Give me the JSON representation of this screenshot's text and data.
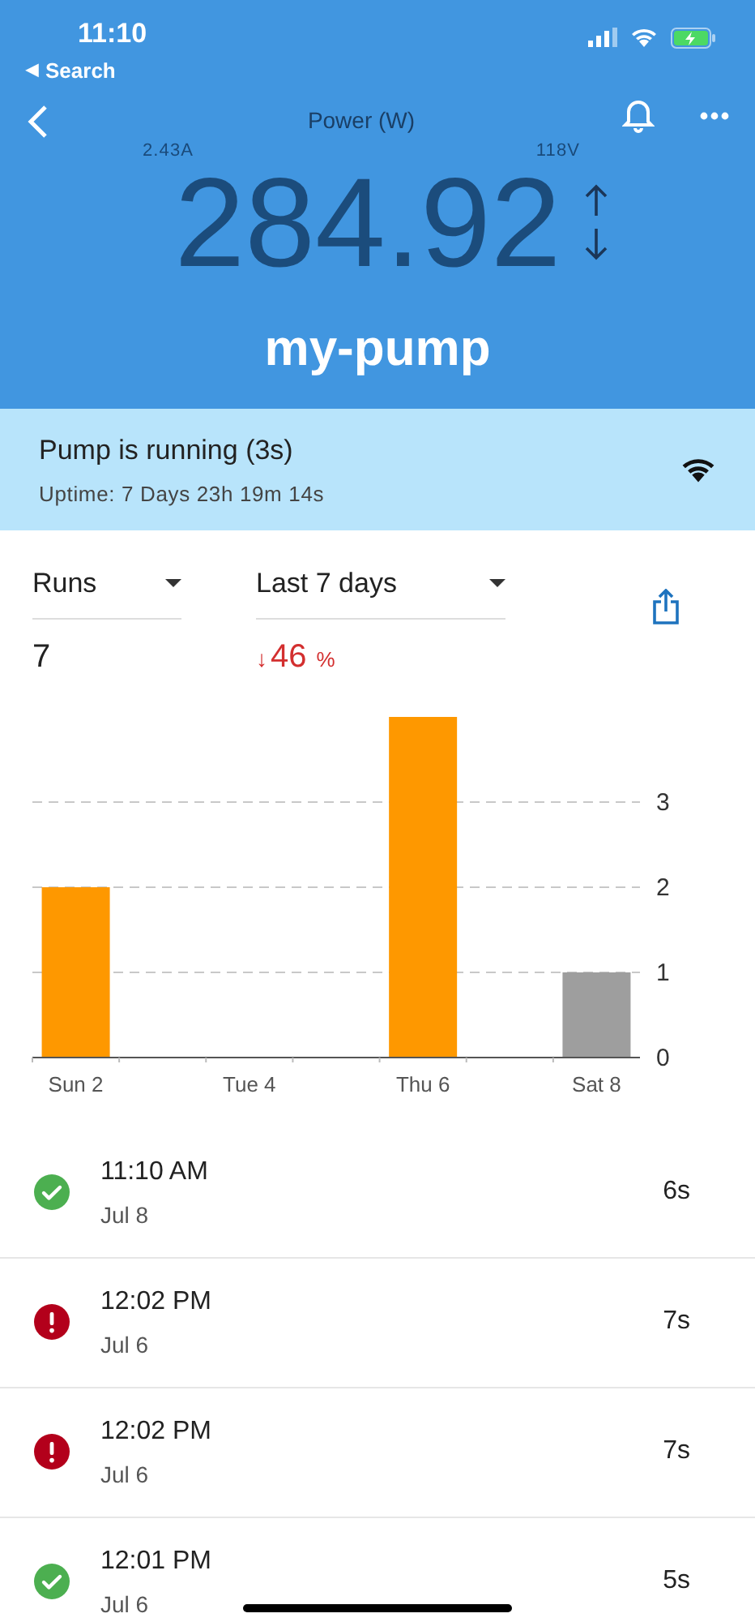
{
  "status_bar": {
    "time": "11:10",
    "back_arrow": "◀",
    "back_label": "Search"
  },
  "header": {
    "title": "Power (W)",
    "current": "2.43A",
    "voltage": "118V",
    "value": "284.92",
    "device": "my-pump"
  },
  "status": {
    "text": "Pump is running (3s)",
    "uptime": "Uptime: 7 Days 23h 19m 14s"
  },
  "filters": {
    "metric": "Runs",
    "period": "Last 7 days",
    "count": "7",
    "change": "46",
    "change_unit": "%",
    "change_arrow": "↓"
  },
  "chart_data": {
    "type": "bar",
    "categories": [
      "Sun 2",
      null,
      "Tue 4",
      null,
      "Thu 6",
      null,
      "Sat 8"
    ],
    "series": [
      {
        "color": "#fe9800",
        "values": [
          2,
          0,
          0,
          0,
          4,
          0,
          null
        ]
      },
      {
        "color": "#9e9e9e",
        "values": [
          null,
          null,
          null,
          null,
          null,
          null,
          1
        ]
      }
    ],
    "ylim": [
      0,
      4
    ],
    "yticks": [
      0,
      1,
      2,
      3
    ],
    "grid": true
  },
  "runs": [
    {
      "kind": "ok",
      "time": "11:10 AM",
      "date": "Jul 8",
      "duration": "6s"
    },
    {
      "kind": "error",
      "time": "12:02 PM",
      "date": "Jul 6",
      "duration": "7s"
    },
    {
      "kind": "error",
      "time": "12:02 PM",
      "date": "Jul 6",
      "duration": "7s"
    },
    {
      "kind": "ok",
      "time": "12:01 PM",
      "date": "Jul 6",
      "duration": "5s"
    }
  ]
}
